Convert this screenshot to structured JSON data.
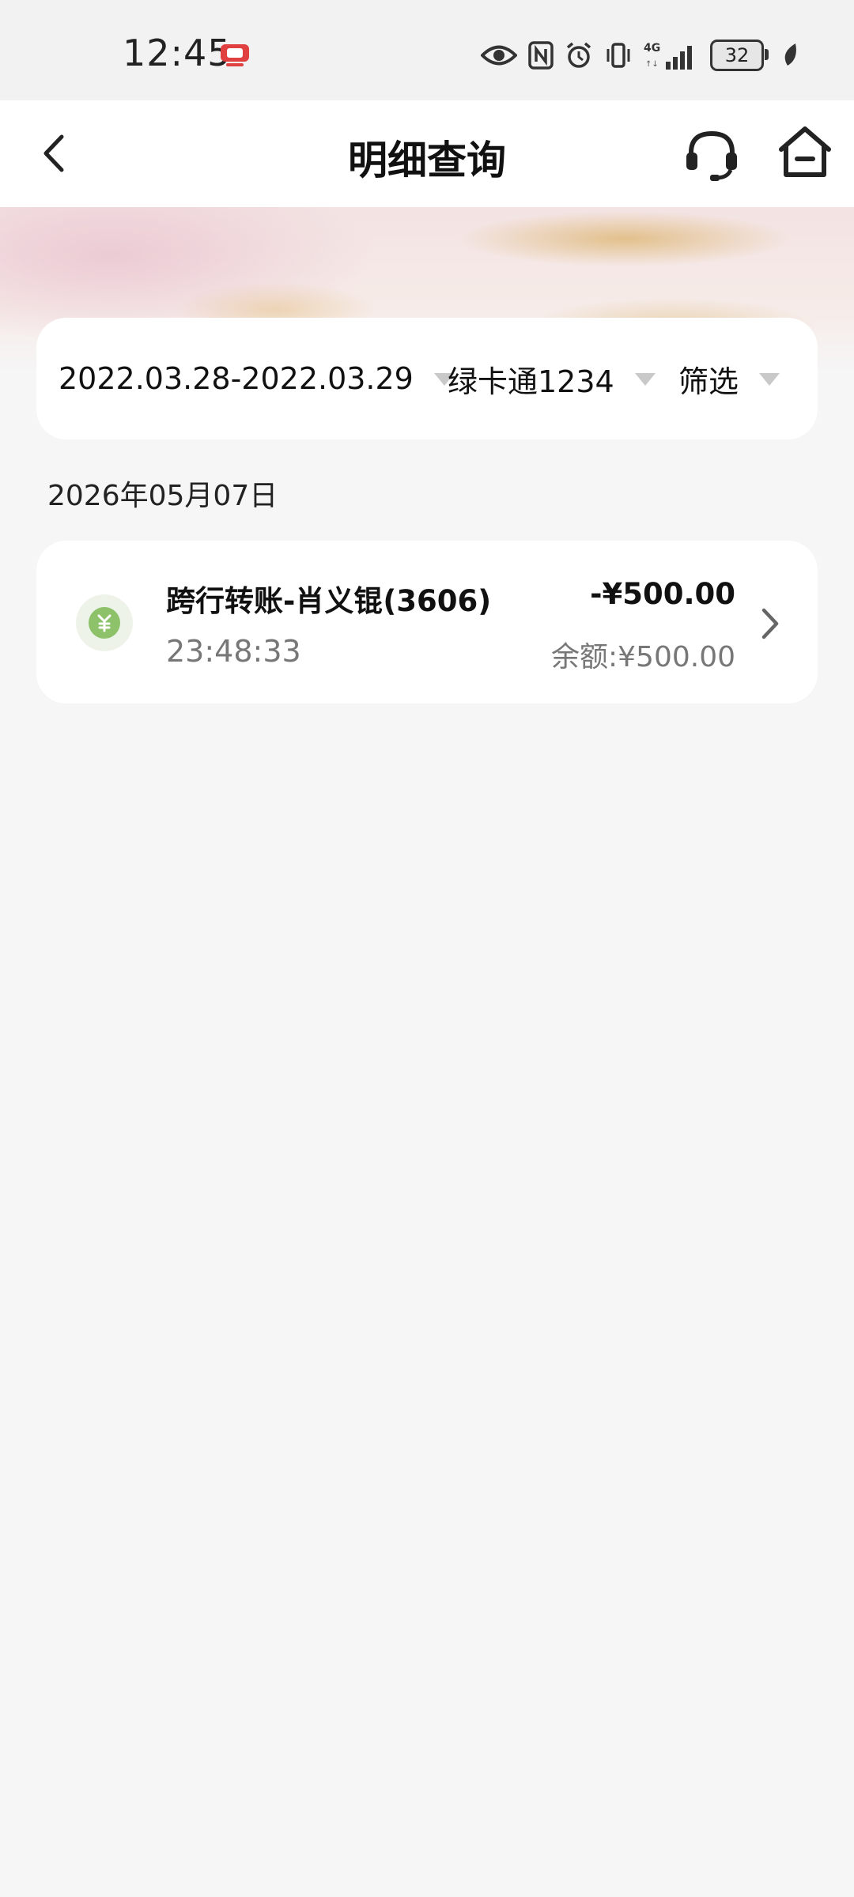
{
  "status_bar": {
    "time": "12:45",
    "battery": "32",
    "icons": [
      "eye-icon",
      "nfc-icon",
      "alarm-icon",
      "vibrate-icon",
      "4g-icon",
      "signal-icon",
      "battery-icon",
      "leaf-icon"
    ]
  },
  "nav": {
    "title": "明细查询",
    "back_icon": "chevron-left-icon",
    "service_icon": "headset-icon",
    "home_icon": "home-icon"
  },
  "filters": {
    "date_range": "2022.03.28-2022.03.29",
    "card": "绿卡通1234",
    "screen": "筛选"
  },
  "groups": [
    {
      "date": "2026年05月07日",
      "transactions": [
        {
          "title": "跨行转账-肖义锟(3606)",
          "time": "23:48:33",
          "amount": "-¥500.00",
          "balance": "余额:¥500.00",
          "icon": "yuan-coin-icon"
        }
      ]
    }
  ],
  "colors": {
    "page_background": "#f6f6f6",
    "card_background": "#ffffff",
    "icon_green": "#8dc26a",
    "caret_gray": "#c9c9c9"
  }
}
